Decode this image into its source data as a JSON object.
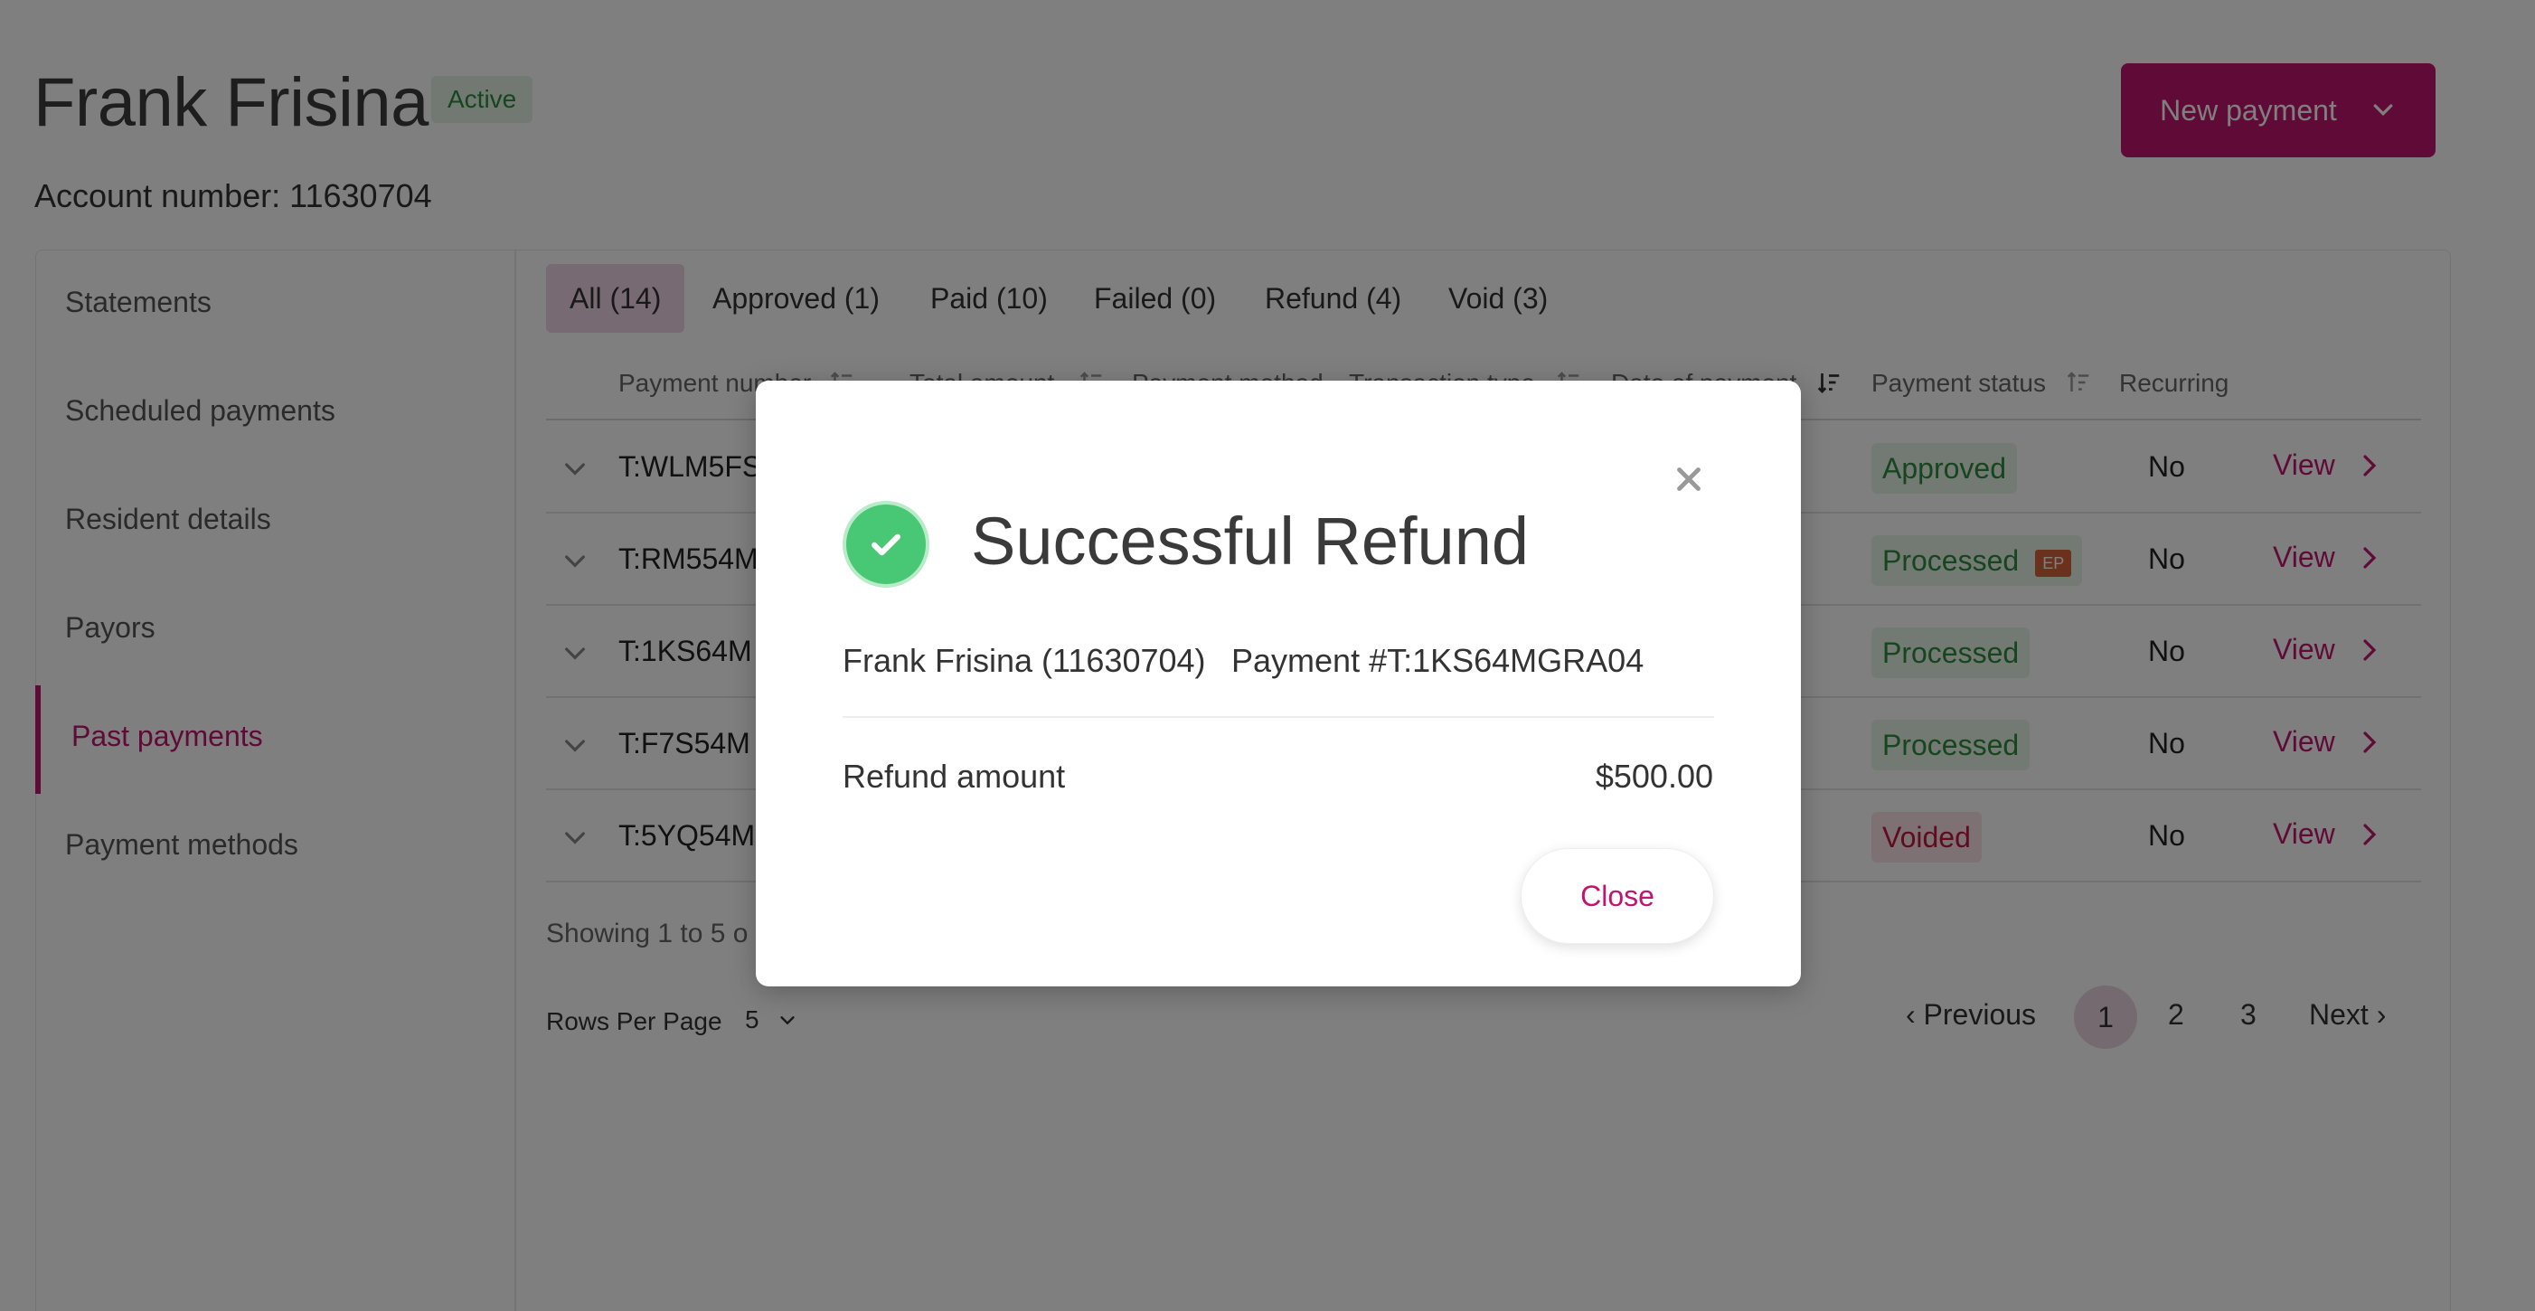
{
  "header": {
    "name": "Frank Frisina",
    "status_badge": "Active",
    "account_number": "Account number: 11630704",
    "new_payment_label": "New payment"
  },
  "sidebar": {
    "items": [
      {
        "label": "Statements"
      },
      {
        "label": "Scheduled payments"
      },
      {
        "label": "Resident details"
      },
      {
        "label": "Payors"
      },
      {
        "label": "Past payments",
        "active": true
      },
      {
        "label": "Payment methods"
      }
    ]
  },
  "tabs": [
    {
      "label": "All (14)",
      "active": true
    },
    {
      "label": "Approved (1)"
    },
    {
      "label": "Paid (10)"
    },
    {
      "label": "Failed (0)"
    },
    {
      "label": "Refund (4)"
    },
    {
      "label": "Void (3)"
    }
  ],
  "table": {
    "columns": [
      "Payment number",
      "Total amount",
      "Payment method",
      "Transaction type",
      "Date of payment",
      "Payment status",
      "Recurring"
    ],
    "rows": [
      {
        "payment_number": "T:WLM5FS",
        "status": "Approved",
        "status_color": "green",
        "recurring": "No",
        "action": "View"
      },
      {
        "payment_number": "T:RM554M",
        "status": "Processed",
        "status_color": "green",
        "tag": "EP",
        "recurring": "No",
        "action": "View"
      },
      {
        "payment_number": "T:1KS64M",
        "status": "Processed",
        "status_color": "green",
        "recurring": "No",
        "action": "View"
      },
      {
        "payment_number": "T:F7S54M",
        "status": "Processed",
        "status_color": "green",
        "recurring": "No",
        "action": "View"
      },
      {
        "payment_number": "T:5YQ54M",
        "status": "Voided",
        "status_color": "red",
        "recurring": "No",
        "action": "View"
      }
    ]
  },
  "footer": {
    "showing": "Showing 1 to 5 o",
    "rows_per_page_label": "Rows Per Page",
    "rows_per_page_value": "5",
    "pagination": {
      "previous": "Previous",
      "pages": [
        "1",
        "2",
        "3"
      ],
      "current": "1",
      "next": "Next"
    }
  },
  "modal": {
    "title": "Successful Refund",
    "resident": "Frank Frisina (11630704)",
    "payment": "Payment #T:1KS64MGRA04",
    "refund_label": "Refund amount",
    "refund_amount": "$500.00",
    "close_label": "Close"
  },
  "colors": {
    "brand": "#c0156f",
    "success": "#48c774",
    "status_green": "#2e8b3e",
    "status_red": "#c0183f",
    "ep_tag": "#d9633a"
  }
}
